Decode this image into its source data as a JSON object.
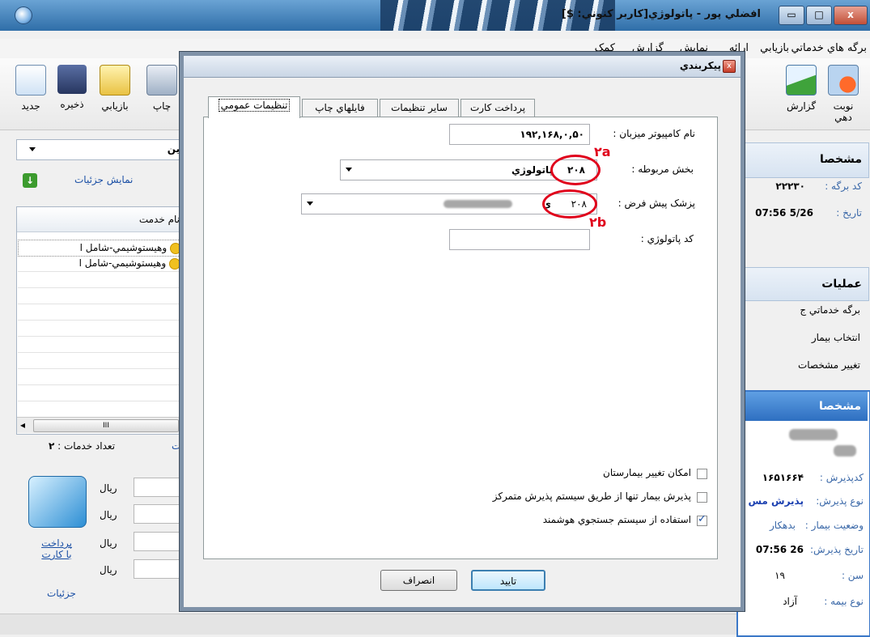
{
  "window": {
    "title": "افضلي پور - پاتولوژي[کاربر کنوني: $]"
  },
  "menu": [
    "برگه هاي خدماتي",
    "بازيابي",
    "ارائه",
    "نمايش",
    "گزارش",
    "کمک"
  ],
  "toolbar": {
    "left": [
      {
        "label": "جديد",
        "icon": "new-document-icon"
      },
      {
        "label": "ذخيره",
        "icon": "save-disk-icon"
      },
      {
        "label": "بازيابي",
        "icon": "open-folder-icon"
      },
      {
        "label": "چاپ",
        "icon": "printer-icon"
      }
    ],
    "right": [
      {
        "label": "نوبت دهي",
        "icon": "appointment-clock-icon"
      },
      {
        "label": "گزارش",
        "icon": "chart-report-icon"
      }
    ],
    "right_partial": "ج"
  },
  "left_panel": {
    "dropdown_value": "ين",
    "details_link": "نمايش جزئيات",
    "grid_header": "نام خدمت",
    "rows": [
      "وهيستوشيمي-شامل ا",
      "وهيستوشيمي-شامل ا"
    ],
    "scroll_mid": "III",
    "service_count_label": "تعداد خدمات :",
    "service_count": "۲",
    "right_fragment": "ت",
    "currency": [
      "ريال",
      "ريال",
      "ريال",
      "ريال"
    ],
    "pay_card_link": "پرداخت با کارت",
    "details_footer": "جزئيات"
  },
  "right_panel": {
    "section1_title": "مشخصا",
    "card_code_label": "کد برگه :",
    "card_code_value": "۲۲۲۳۰",
    "date_label": "تاريخ :",
    "date_value": "5/26 07:56",
    "ops_title": "عمليات",
    "ops": [
      "برگه خدماتي ج",
      "انتخاب بيمار",
      "تغيير مشخصات"
    ],
    "section2_title": "مشخصا",
    "admit_code_label": "کدپذيرش :",
    "admit_code_value": "۱۶۵۱۶۶۴",
    "admit_type_label": "نوع پذيرش:",
    "admit_type_value": "پذيرش مس",
    "patient_status_label": "وضعيت بيمار :",
    "patient_status_value": "بدهکار",
    "admit_date_label": "تاريخ پذيرش:",
    "admit_date_value": "26 07:56",
    "age_label": "سن :",
    "age_value": "۱۹",
    "insurance_label": "نوع بيمه :",
    "insurance_value": "آزاد"
  },
  "dialog": {
    "title": "پيکربندي",
    "tabs": [
      "تنظيمات عمومي",
      "فايلهاي چاپ",
      "ساير تنظيمات",
      "پرداخت کارت"
    ],
    "fields": {
      "server_label": "نام کامپيوتر ميزبان :",
      "server_value": "۱۹۲,۱۶۸,۰,۵۰",
      "section_label": "بخش مربوطه :",
      "section_value": "پاتولوژي",
      "section_code": "۲۰۸",
      "doctor_label": "پزشک پيش فرض :",
      "doctor_code": "۲۰۸",
      "doctor_suffix": "ي",
      "pathology_code_label": "کد پاتولوژي :",
      "pathology_code_value": ""
    },
    "annotations": {
      "a": "۲a",
      "b": "۲b"
    },
    "checkboxes": [
      {
        "label": "امکان تغيير بيمارستان",
        "checked": false
      },
      {
        "label": "پذيرش بيمار تنها از طريق سيستم پذيرش متمرکز",
        "checked": false
      },
      {
        "label": "استفاده از سيستم جستجوي هوشمند",
        "checked": true
      }
    ],
    "ok_label": "تاييد",
    "cancel_label": "انصراف"
  }
}
